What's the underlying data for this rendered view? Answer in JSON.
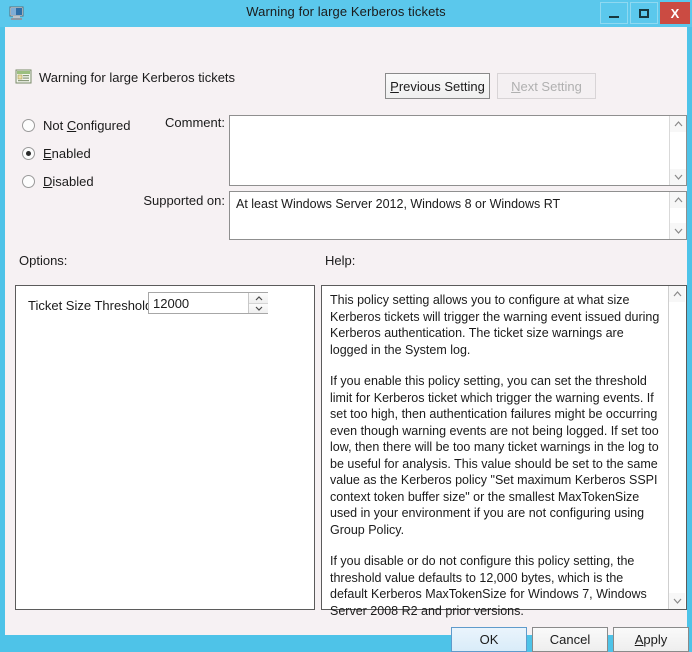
{
  "window": {
    "title": "Warning for large Kerberos tickets",
    "icon": "computer-policy-icon",
    "controls": {
      "minimize": "minimize-icon",
      "maximize": "maximize-icon",
      "close": "X"
    }
  },
  "header": {
    "icon": "policy-setting-icon",
    "title": "Warning for large Kerberos tickets",
    "previous_setting": "Previous Setting",
    "previous_setting_accel": "P",
    "next_setting": "Next Setting",
    "next_setting_accel": "N",
    "next_setting_enabled": false
  },
  "state_options": [
    {
      "label": "Not Configured",
      "accel_before": "Not ",
      "accel": "C",
      "accel_after": "onfigured",
      "selected": false
    },
    {
      "label": "Enabled",
      "accel_before": "",
      "accel": "E",
      "accel_after": "nabled",
      "selected": true
    },
    {
      "label": "Disabled",
      "accel_before": "",
      "accel": "D",
      "accel_after": "isabled",
      "selected": false
    }
  ],
  "fields": {
    "comment_label": "Comment:",
    "comment_value": "",
    "supported_label": "Supported on:",
    "supported_value": "At least Windows Server 2012, Windows 8 or Windows RT"
  },
  "sections": {
    "options_label": "Options:",
    "help_label": "Help:"
  },
  "options": {
    "setting_label": "Ticket Size Threshold",
    "setting_value": "12000"
  },
  "help": {
    "paragraphs": [
      "This policy setting allows you to configure at what size Kerberos tickets will trigger the warning event issued during Kerberos authentication. The ticket size warnings are logged in the System log.",
      "If you enable this policy setting, you can set the threshold limit for Kerberos ticket which trigger the warning events. If set too high, then authentication failures might be occurring even though warning events are not being logged.  If set too low, then there will be too many ticket warnings in the log to be useful for analysis. This value should be set to the same value as the Kerberos policy \"Set maximum Kerberos SSPI context token buffer size\" or the smallest MaxTokenSize used in your environment if you are not configuring using Group Policy.",
      "If you disable or do not configure this policy setting, the threshold value defaults to 12,000 bytes, which is the default Kerberos MaxTokenSize for Windows 7, Windows Server 2008 R2 and prior versions."
    ]
  },
  "buttons": {
    "ok": "OK",
    "cancel": "Cancel",
    "apply": "Apply",
    "apply_accel": "A"
  },
  "colors": {
    "titlebar": "#5BC8EC",
    "frame": "#4EC3E8",
    "dialog_bg": "#F6F1F3",
    "close_button": "#CB4B42",
    "default_button_border": "#5F9BCB"
  }
}
